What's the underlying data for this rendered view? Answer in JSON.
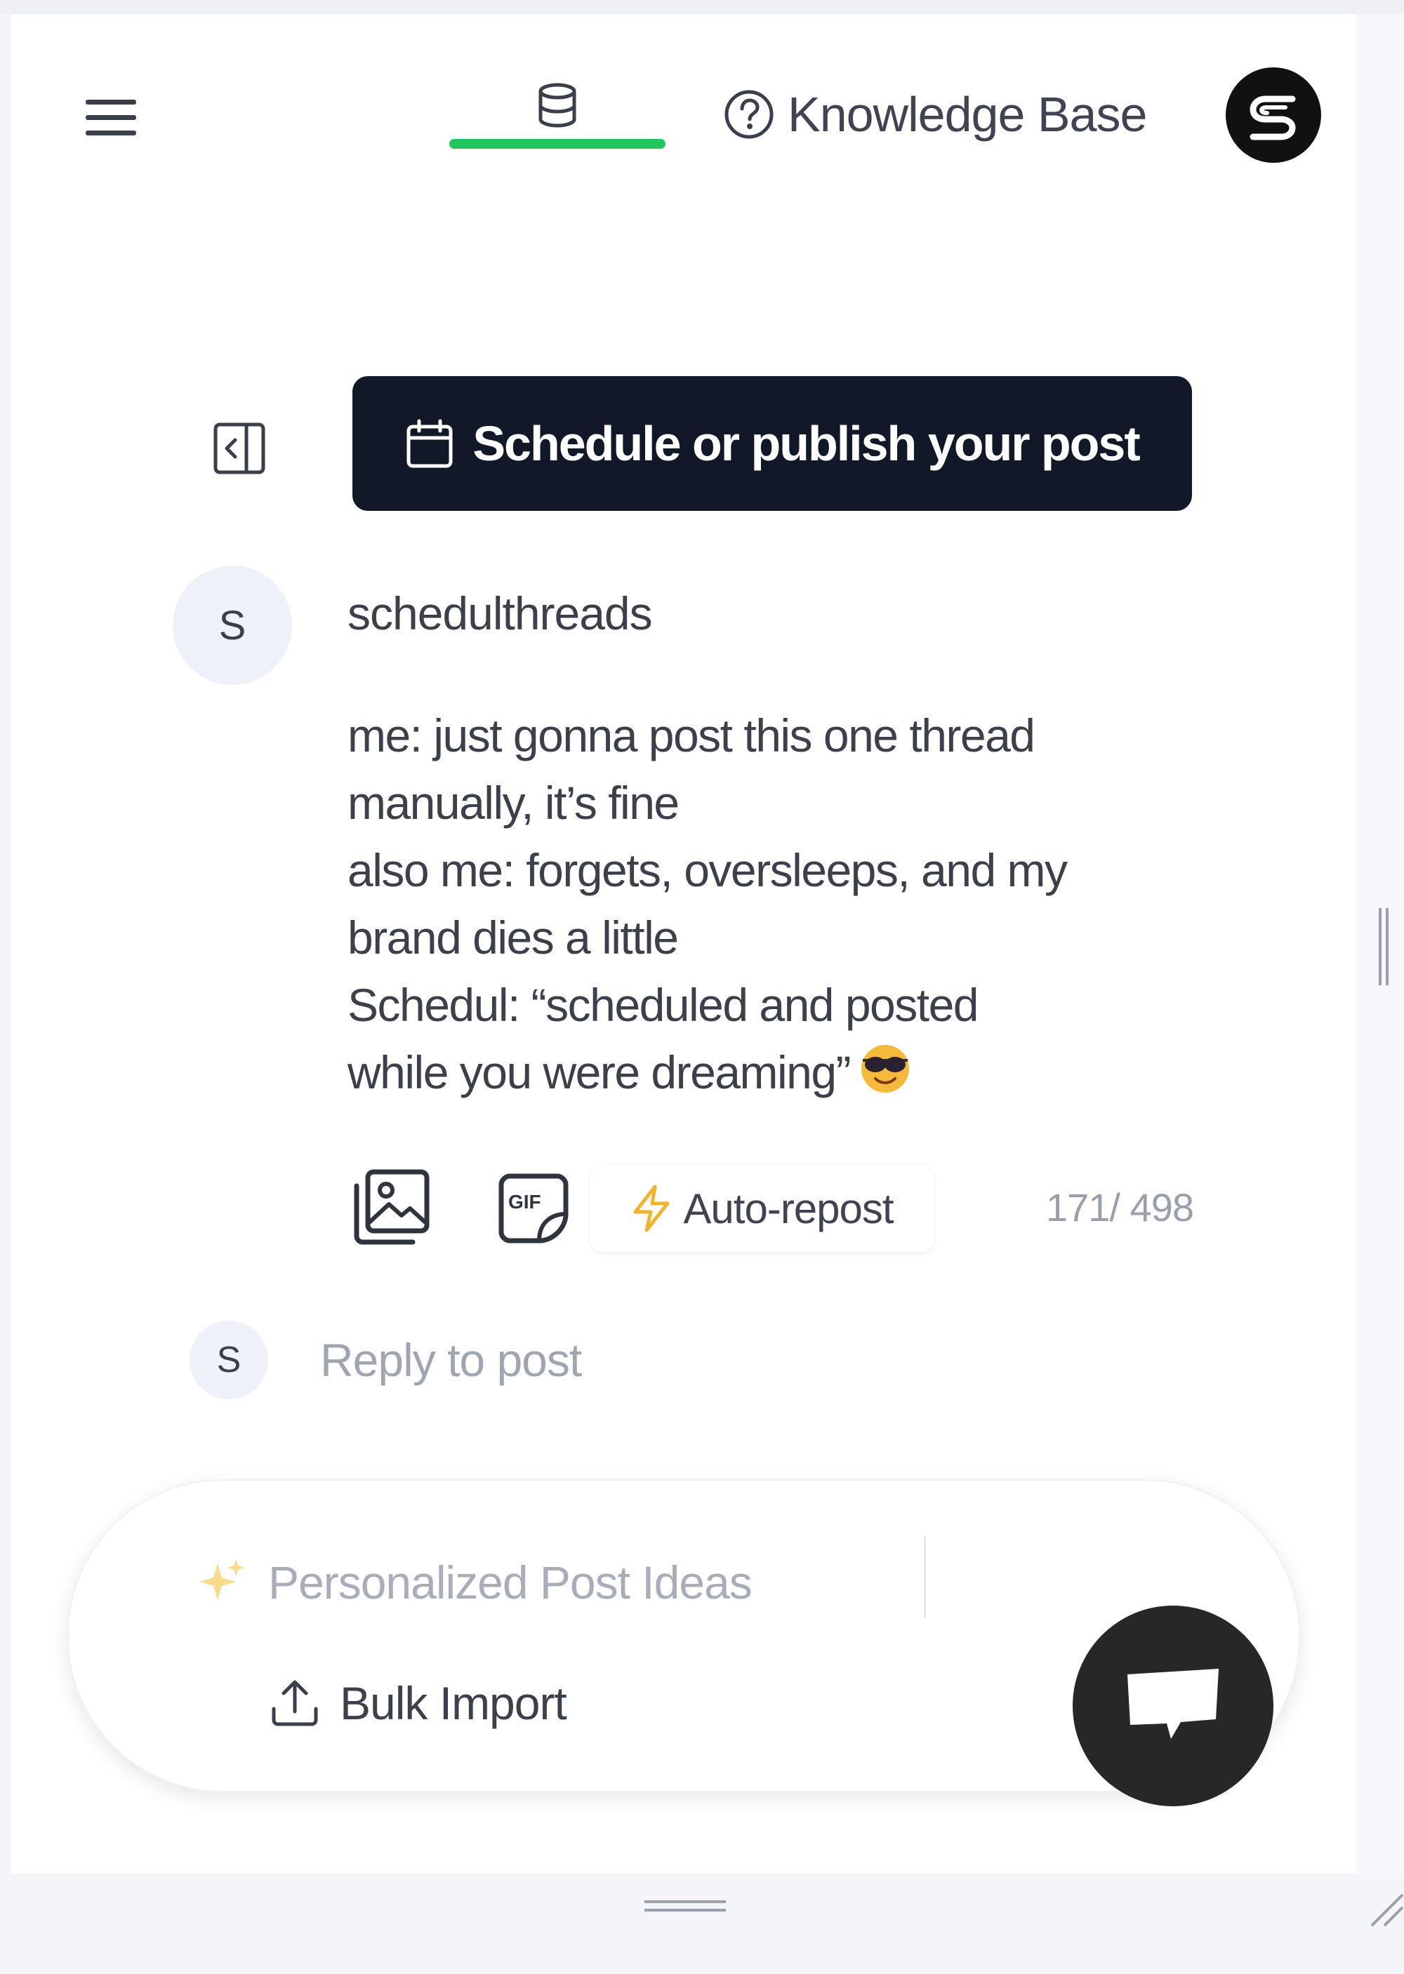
{
  "header": {
    "menu_icon": "hamburger-menu-icon",
    "database_tab_icon": "database-icon",
    "active_tab_color": "#22c55e",
    "knowledge_base_label": "Knowledge Base",
    "knowledge_base_icon": "question-circle-icon",
    "app_logo": "S"
  },
  "toolbar": {
    "panel_toggle_icon": "panel-left-collapse-icon",
    "schedule_button_label": "Schedule or publish your post",
    "schedule_button_icon": "calendar-icon",
    "schedule_button_color": "#111827"
  },
  "post": {
    "avatar_initial": "S",
    "username": "schedulthreads",
    "body_lines": [
      "me: just gonna post this one thread",
      "manually, it’s fine",
      "also me: forgets, oversleeps, and my",
      "brand dies a little",
      "Schedul: “scheduled and posted",
      "while you were dreaming”"
    ],
    "emoji": "😎",
    "actions": {
      "image_icon": "image-upload-icon",
      "gif_icon": "gif-icon",
      "auto_repost_label": "Auto-repost",
      "auto_repost_icon": "lightning-bolt-icon",
      "char_count": "171/ 498"
    }
  },
  "reply": {
    "avatar_initial": "S",
    "placeholder": "Reply to post"
  },
  "floating_bar": {
    "ideas_label": "Personalized Post Ideas",
    "ideas_icon": "sparkles-icon",
    "bulk_import_label": "Bulk Import",
    "bulk_import_icon": "upload-icon"
  },
  "chat_fab_icon": "chat-bubble-icon"
}
